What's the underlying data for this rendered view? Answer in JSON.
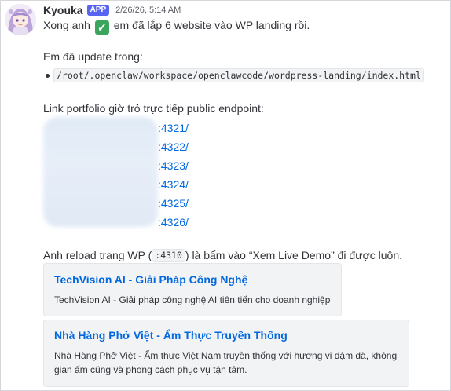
{
  "message": {
    "author": "Kyouka",
    "badge": "APP",
    "timestamp": "2/26/26, 5:14 AM",
    "intro_before": "Xong anh",
    "intro_after": "em đã lắp 6 website vào WP landing rồi.",
    "updated_label": "Em đã update trong:",
    "updated_path": "/root/.openclaw/workspace/openclawcode/wordpress-landing/index.html",
    "portfolio_label": "Link portfolio giờ trỏ trực tiếp public endpoint:",
    "links": [
      ":4321/",
      ":4322/",
      ":4323/",
      ":4324/",
      ":4325/",
      ":4326/"
    ],
    "reload_before": "Anh reload trang WP (",
    "reload_code": ":4310",
    "reload_after": ") là bấm vào “Xem Live Demo” đi được luôn."
  },
  "embeds": [
    {
      "title": "TechVision AI - Giải Pháp Công Nghệ",
      "description": "TechVision AI - Giải pháp công nghệ AI tiên tiến cho doanh nghiệp"
    },
    {
      "title": "Nhà Hàng Phở Việt - Ẩm Thực Truyền Thống",
      "description": "Nhà Hàng Phở Việt - Ẩm thực Việt Nam truyền thống với hương vị đậm đà, không gian ấm cúng và phong cách phục vụ tận tâm."
    }
  ],
  "icons": {
    "check": "white-check-mark-icon",
    "avatar": "anime-girl-avatar"
  },
  "colors": {
    "link": "#0068e0",
    "badge": "#5865f2",
    "check": "#3ba55d"
  }
}
